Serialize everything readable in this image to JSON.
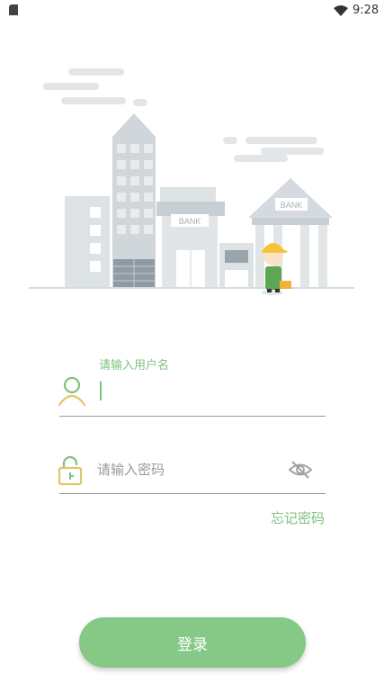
{
  "status_bar": {
    "time": "9:28",
    "icons": [
      "sd-card-icon",
      "wifi-icon"
    ]
  },
  "illustration": {
    "bank_sign_left": "BANK",
    "bank_sign_right": "BANK"
  },
  "login": {
    "username_label": "请输入用户名",
    "username_value": "",
    "password_placeholder": "请输入密码",
    "password_value": "",
    "forgot_password": "忘记密码",
    "submit_label": "登录"
  },
  "colors": {
    "accent": "#7ec27e",
    "button": "#86c986",
    "icon_yellow": "#e2c56b",
    "divider": "#9a9a9a"
  }
}
